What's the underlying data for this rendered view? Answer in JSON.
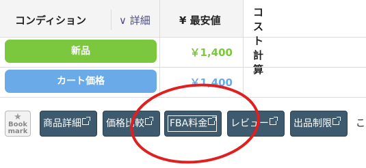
{
  "table": {
    "header": {
      "condition": "コンディション",
      "sort": "∨ 詳細",
      "lowest_price": "¥ 最安値",
      "cost_calc": "コスト計算"
    },
    "rows": [
      {
        "label": "新品",
        "price": "￥1,400"
      },
      {
        "label": "カート価格",
        "price": "￥1,400"
      }
    ]
  },
  "toolbar": {
    "bookmark_line1": "Book",
    "bookmark_line2": "mark",
    "buttons": [
      "商品詳細",
      "価格比較",
      "FBA料金",
      "レビュー",
      "出品制限"
    ],
    "trailing_text": "こ"
  },
  "colors": {
    "new_pill": "#7bc73d",
    "cart_pill": "#6aaae8",
    "button_bg": "#3d5a6e",
    "annotation_ring": "#e02020"
  },
  "icons": {
    "bookmark": "star-icon",
    "external_link": "external-link-icon"
  }
}
